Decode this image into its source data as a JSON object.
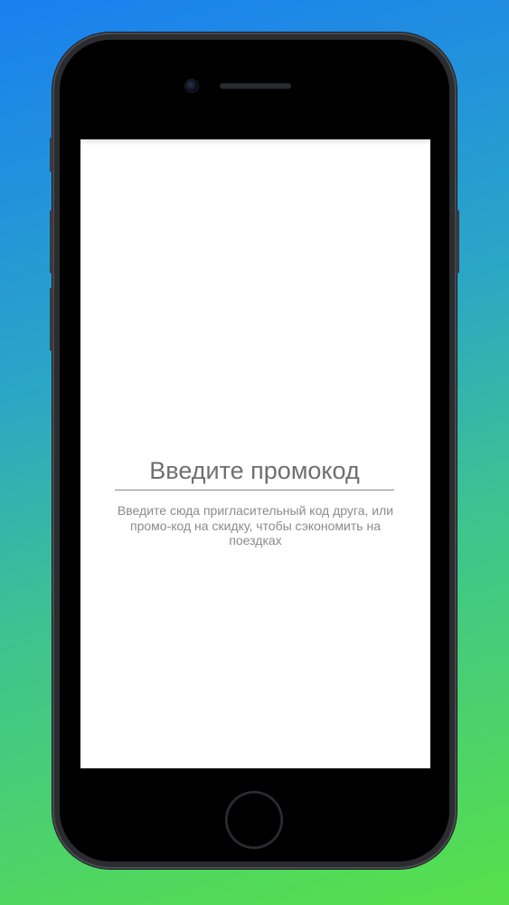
{
  "promo": {
    "placeholder": "Введите промокод",
    "hint": "Введите сюда пригласительный код друга, или промо-код на скидку, чтобы сэкономить на поездках"
  },
  "colors": {
    "background_top": "#1a7ff0",
    "background_bottom": "#57e04a",
    "phone_body": "#2b2c30",
    "screen": "#ffffff"
  }
}
